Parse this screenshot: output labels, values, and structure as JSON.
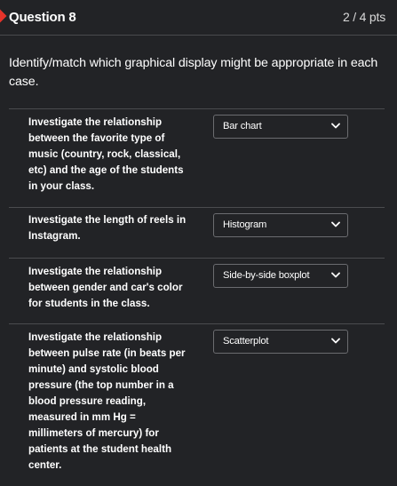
{
  "question": {
    "title": "Question 8",
    "points": "2 / 4 pts",
    "prompt": "Identify/match which graphical display might be appropriate in each case."
  },
  "rows": [
    {
      "text": "Investigate the relationship between the favorite type of music (country, rock, classical, etc) and the age of the students in your class.",
      "selected": "Bar chart"
    },
    {
      "text": "Investigate the length of reels in Instagram.",
      "selected": "Histogram"
    },
    {
      "text": "Investigate the relationship between gender and car's color for students in the class.",
      "selected": "Side-by-side boxplot"
    },
    {
      "text": "Investigate the relationship between pulse rate (in beats per minute) and systolic blood pressure (the top number in a blood pressure reading, measured in mm Hg = millimeters of mercury) for patients at the student health center.",
      "selected": "Scatterplot"
    }
  ],
  "colors": {
    "background": "#222326",
    "flag": "#e6332a",
    "divider": "#4a4b4e"
  }
}
